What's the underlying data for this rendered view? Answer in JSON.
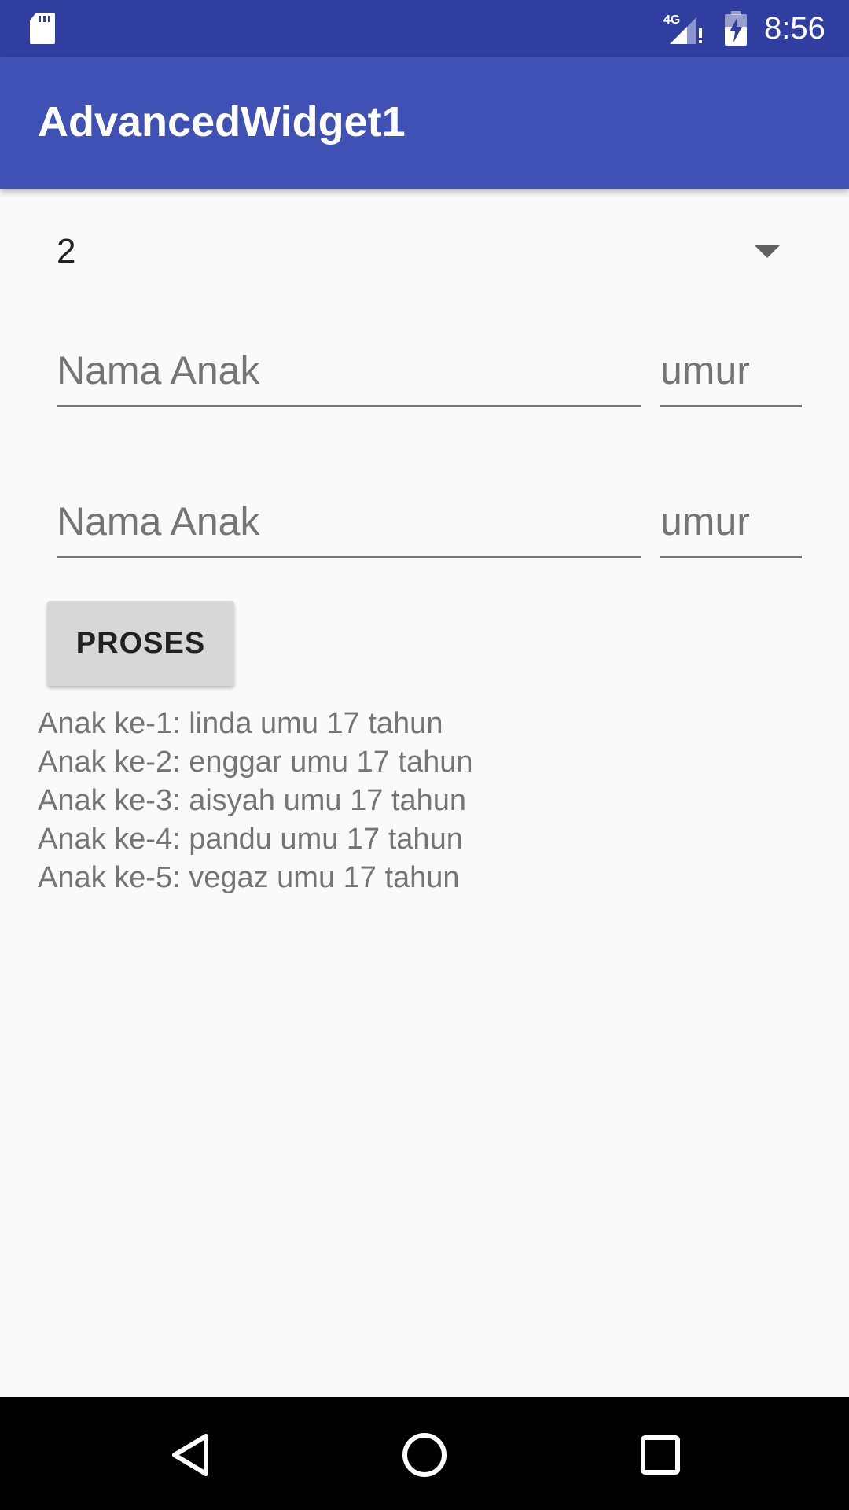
{
  "status_bar": {
    "time": "8:56",
    "network": "4G",
    "icons": [
      "sd-card-icon",
      "signal-icon",
      "battery-charging-icon"
    ]
  },
  "app_bar": {
    "title": "AdvancedWidget1",
    "color": "#3f51b5",
    "status_color": "#303f9f"
  },
  "spinner": {
    "selected": "2"
  },
  "rows": [
    {
      "name_placeholder": "Nama Anak",
      "age_placeholder": "umur",
      "name_value": "",
      "age_value": ""
    },
    {
      "name_placeholder": "Nama Anak",
      "age_placeholder": "umur",
      "name_value": "",
      "age_value": ""
    }
  ],
  "button": {
    "label": "PROSES"
  },
  "results": [
    "Anak ke-1: linda umu 17 tahun",
    "Anak ke-2: enggar umu 17 tahun",
    "Anak ke-3: aisyah umu 17 tahun",
    "Anak ke-4: pandu umu 17 tahun",
    "Anak ke-5: vegaz umu 17 tahun"
  ],
  "nav_bar": {
    "icons": [
      "back-icon",
      "home-icon",
      "recents-icon"
    ]
  }
}
